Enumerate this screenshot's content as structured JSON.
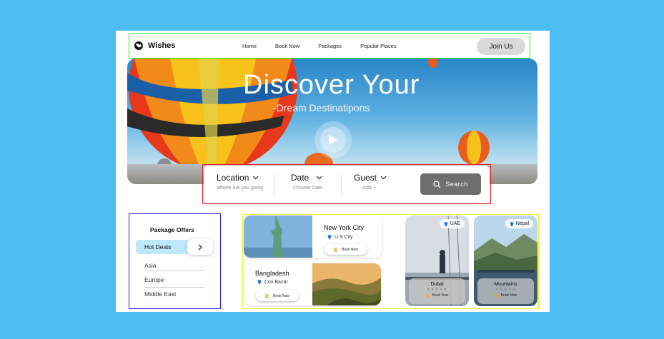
{
  "nav": {
    "logo_text": "Wishes",
    "links": [
      "Home",
      "Book Now",
      "Packages",
      "Popular Places"
    ],
    "join_label": "Join Us"
  },
  "hero": {
    "title": "Discover Your",
    "subtitle": "-Dream Destinatipons"
  },
  "search": {
    "location_label": "Location",
    "location_hint": "Where are you going",
    "date_label": "Date",
    "date_hint": "Choose Date",
    "guest_label": "Guest",
    "guest_hint": "-Add +",
    "button_label": "Search"
  },
  "offers": {
    "title": "Package Offers",
    "hot_label": "Hot Deals",
    "regions": [
      "Asia",
      "Europe",
      "Middle East"
    ]
  },
  "destinations": {
    "book_label": "Book Now",
    "new_york": {
      "title": "New York City",
      "location": "U.S City"
    },
    "bangladesh": {
      "title": "Bangladesh",
      "location": "Cox Bazar"
    },
    "dubai": {
      "tag": "UAE",
      "name": "Dubai",
      "stars": "★★★★★"
    },
    "mountains": {
      "tag": "Nepal",
      "name": "Mountains",
      "stars": "★★★★★"
    }
  },
  "colors": {
    "background": "#4cbef4",
    "hot_deals": "#bfe9fb",
    "search_button": "#6e6e6e",
    "pin_blue": "#1e7bd6",
    "book_icon": "#f2a413"
  }
}
